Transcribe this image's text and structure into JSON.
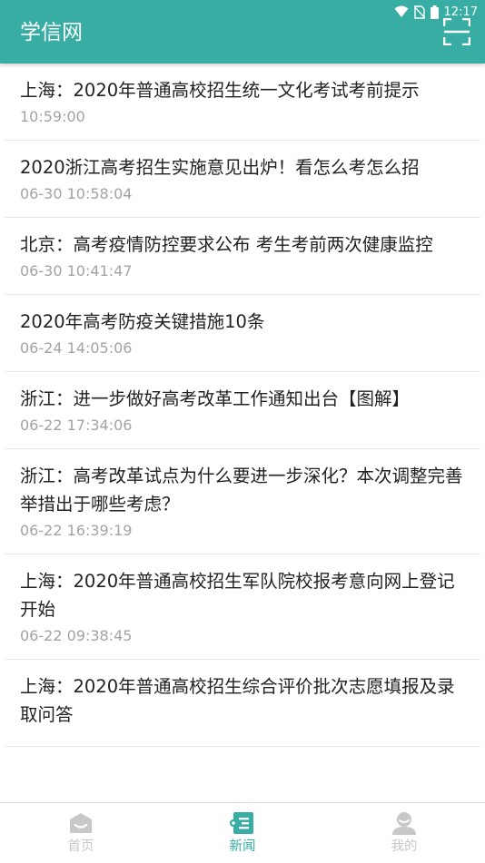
{
  "status_bar": {
    "time": "12:17"
  },
  "app_bar": {
    "title": "学信网",
    "scan_icon": "scan-frame-icon"
  },
  "news": [
    {
      "title": "上海：2020年普通高校招生统一文化考试考前提示",
      "time": "10:59:00"
    },
    {
      "title": "2020浙江高考招生实施意见出炉！看怎么考怎么招",
      "time": "06-30 10:58:04"
    },
    {
      "title": "北京：高考疫情防控要求公布 考生考前两次健康监控",
      "time": "06-30 10:41:47"
    },
    {
      "title": "2020年高考防疫关键措施10条",
      "time": "06-24 14:05:06"
    },
    {
      "title": "浙江：进一步做好高考改革工作通知出台【图解】",
      "time": "06-22 17:34:06"
    },
    {
      "title": "浙江：高考改革试点为什么要进一步深化？本次调整完善举措出于哪些考虑？",
      "time": "06-22 16:39:19"
    },
    {
      "title": "上海：2020年普通高校招生军队院校报考意向网上登记开始",
      "time": "06-22 09:38:45"
    },
    {
      "title": "上海：2020年普通高校招生综合评价批次志愿填报及录取问答",
      "time": ""
    }
  ],
  "tabs": [
    {
      "label": "首页",
      "icon": "home-icon",
      "active": false
    },
    {
      "label": "新闻",
      "icon": "news-icon",
      "active": true
    },
    {
      "label": "我的",
      "icon": "profile-icon",
      "active": false
    }
  ],
  "colors": {
    "accent": "#37ada4",
    "inactive": "#c8c8c8",
    "time_text": "#a3a3a3"
  }
}
